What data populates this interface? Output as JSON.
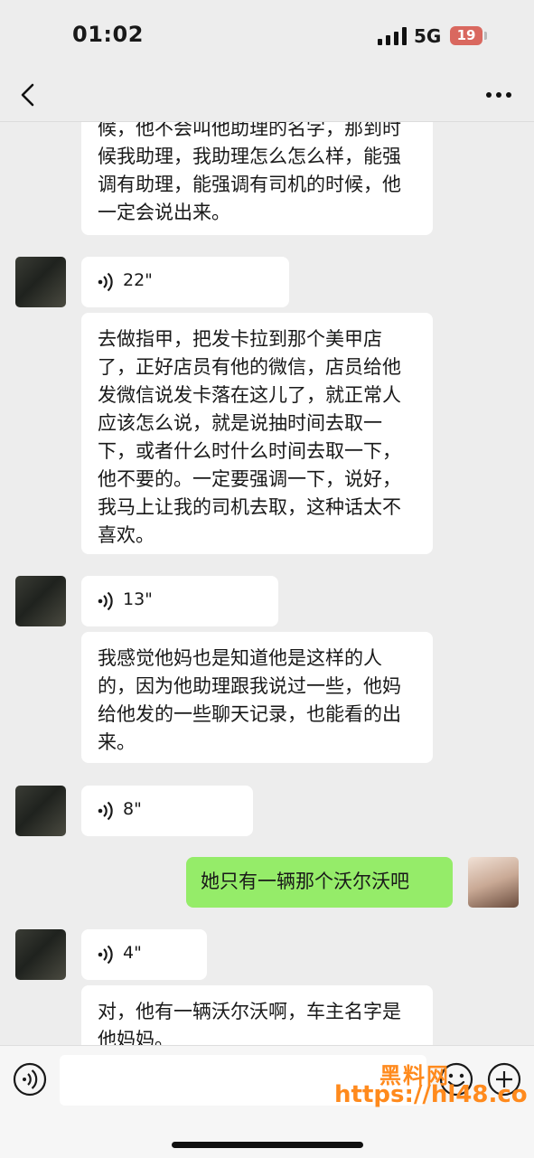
{
  "status_bar": {
    "time": "01:02",
    "network": "5G",
    "battery": "19"
  },
  "nav": {
    "back_icon": "chevron-left-icon",
    "more_icon": "more-dots-icon"
  },
  "messages": [
    {
      "side": "left",
      "type": "text",
      "text": "候，他不会叫他助理的名字，那到时候我助理，我助理怎么怎么样，能强调有助理，能强调有司机的时候，他一定会说出来。"
    },
    {
      "side": "left",
      "type": "voice",
      "duration": "22\""
    },
    {
      "side": "left",
      "type": "text",
      "text": "去做指甲，把发卡拉到那个美甲店了，正好店员有他的微信，店员给他发微信说发卡落在这儿了，就正常人应该怎么说，就是说抽时间去取一下，或者什么时什么时间去取一下，他不要的。一定要强调一下，说好，我马上让我的司机去取，这种话太不喜欢。"
    },
    {
      "side": "left",
      "type": "voice",
      "duration": "13\""
    },
    {
      "side": "left",
      "type": "text",
      "text": "我感觉他妈也是知道他是这样的人的，因为他助理跟我说过一些，他妈给他发的一些聊天记录，也能看的出来。"
    },
    {
      "side": "left",
      "type": "voice",
      "duration": "8\""
    },
    {
      "side": "right",
      "type": "text",
      "text": "她只有一辆那个沃尔沃吧"
    },
    {
      "side": "left",
      "type": "voice",
      "duration": "4\""
    },
    {
      "side": "left",
      "type": "text",
      "text": "对，他有一辆沃尔沃啊，车主名字是他妈妈。"
    }
  ],
  "input_bar": {
    "voice_icon": "voice-input-icon",
    "input_value": "",
    "emoji_icon": "emoji-icon",
    "plus_icon": "plus-icon"
  },
  "watermark": {
    "line1": "黑料网",
    "line2": "https://hl48.co"
  }
}
